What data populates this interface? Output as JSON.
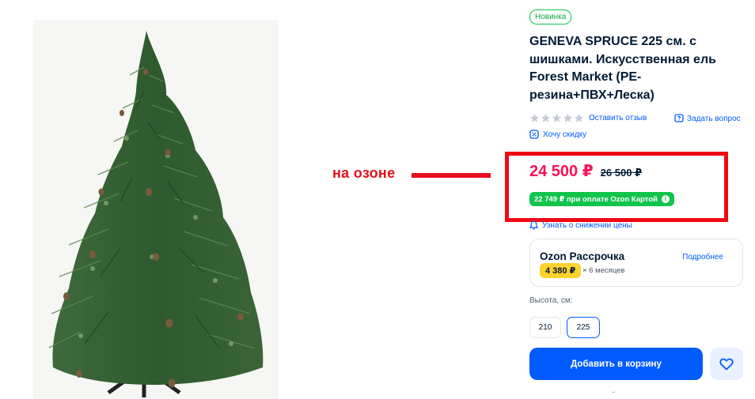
{
  "badge": "Новинка",
  "title": "GENEVA SPRUCE 225 см. с шишками. Искусственная ель Forest Market (PE-резина+ПВХ+Леска)",
  "annotation": {
    "text": "на озоне"
  },
  "rating": {
    "stars": 5,
    "review_link": "Оставить отзыв",
    "ask_link": "Задать вопрос"
  },
  "discount_link": "Хочу скидку",
  "price": {
    "current": "24 500 ₽",
    "old": "26 500 ₽",
    "card_price": "22 749 ₽ при оплате Ozon Картой"
  },
  "notify_link": "Узнать о снижении цены",
  "installment": {
    "title": "Ozon Рассрочка",
    "more": "Подробнее",
    "payment": "4 380 ₽",
    "months": "× 6 месяцев"
  },
  "size": {
    "label": "Высота, см:",
    "options": [
      "210",
      "225"
    ],
    "selected": "225"
  },
  "add_to_cart": "Добавить в корзину",
  "colors": {
    "accent": "#005bff",
    "price": "#f91155",
    "ozon_card": "#10c44c",
    "annotation": "#ee0a14",
    "installment": "#ffd22e"
  },
  "icons": [
    "star-icon",
    "question-icon",
    "discount-icon",
    "bell-icon",
    "info-icon",
    "heart-icon"
  ]
}
